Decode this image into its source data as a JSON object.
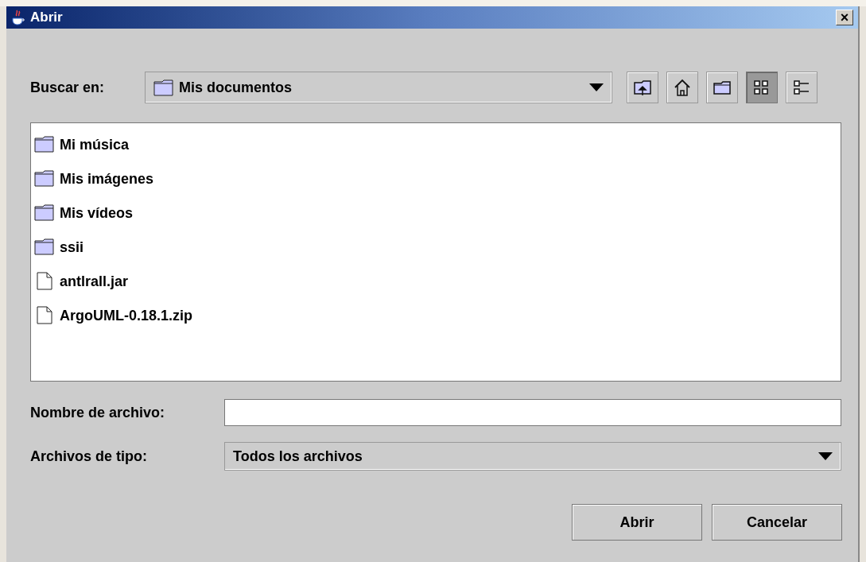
{
  "window": {
    "title": "Abrir",
    "close": "×"
  },
  "look_in": {
    "label": "Buscar en:",
    "value": "Mis documentos"
  },
  "toolbar": [
    {
      "kind": "up",
      "selected": false
    },
    {
      "kind": "home",
      "selected": false
    },
    {
      "kind": "newfolder",
      "selected": false
    },
    {
      "kind": "list",
      "selected": true
    },
    {
      "kind": "details",
      "selected": false
    }
  ],
  "files": [
    {
      "name": "Mi música",
      "kind": "folder"
    },
    {
      "name": "Mis imágenes",
      "kind": "folder"
    },
    {
      "name": "Mis vídeos",
      "kind": "folder"
    },
    {
      "name": "ssii",
      "kind": "folder"
    },
    {
      "name": "antlrall.jar",
      "kind": "file"
    },
    {
      "name": "ArgoUML-0.18.1.zip",
      "kind": "file"
    }
  ],
  "file_name": {
    "label": "Nombre de archivo:"
  },
  "file_type": {
    "label": "Archivos de tipo:",
    "value": "Todos los archivos"
  },
  "buttons": [
    "Abrir",
    "Cancelar"
  ]
}
